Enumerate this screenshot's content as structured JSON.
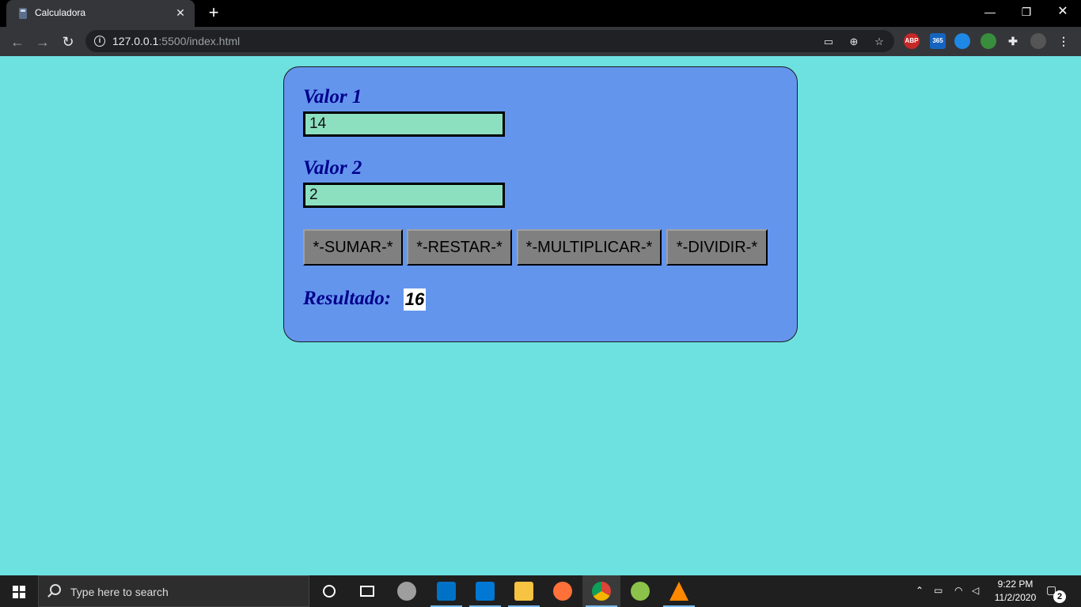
{
  "browser": {
    "tab_title": "Calculadora",
    "tab_close": "✕",
    "new_tab": "+",
    "url_host": "127.0.0.1",
    "url_rest": ":5500/index.html",
    "window_controls": {
      "minimize": "—",
      "maximize": "❐",
      "close": "✕"
    },
    "extensions": [
      {
        "name": "adblock-plus-icon",
        "label": "ABP",
        "color": "#c62828"
      },
      {
        "name": "office-365-icon",
        "label": "365",
        "color": "#1565c0"
      },
      {
        "name": "lens-extension-icon",
        "label": "",
        "color": "#1e88e5"
      },
      {
        "name": "translate-extension-icon",
        "label": "",
        "color": "#388e3c"
      },
      {
        "name": "extensions-puzzle-icon",
        "label": "",
        "color": "#35363a"
      },
      {
        "name": "profile-avatar-icon",
        "label": "",
        "color": "#555"
      }
    ]
  },
  "page": {
    "background_color": "#6de0e0",
    "card_color": "#6495ed",
    "valor1": {
      "label": "Valor 1",
      "value": "14"
    },
    "valor2": {
      "label": "Valor 2",
      "value": "2"
    },
    "buttons": {
      "sumar": "*-SUMAR-*",
      "restar": "*-RESTAR-*",
      "multiplicar": "*-MULTIPLICAR-*",
      "dividir": "*-DIVIDIR-*"
    },
    "result": {
      "label": "Resultado:",
      "value": "16"
    }
  },
  "taskbar": {
    "search_placeholder": "Type here to search",
    "time": "9:22 PM",
    "date": "11/2/2020",
    "notification_count": "2",
    "apps": [
      {
        "name": "cortana-icon",
        "color": "#1f1f1f"
      },
      {
        "name": "task-view-icon",
        "color": "#1f1f1f"
      },
      {
        "name": "disk-app-icon",
        "color": "#9e9e9e"
      },
      {
        "name": "outlook-icon",
        "color": "#0072c6"
      },
      {
        "name": "vscode-icon",
        "color": "#0078d4"
      },
      {
        "name": "file-explorer-icon",
        "color": "#f6c342"
      },
      {
        "name": "firefox-icon",
        "color": "#ff7139"
      },
      {
        "name": "chrome-icon",
        "color": "#4caf50"
      },
      {
        "name": "translator-app-icon",
        "color": "#8bc34a"
      },
      {
        "name": "vlc-icon",
        "color": "#ff8800"
      }
    ]
  }
}
